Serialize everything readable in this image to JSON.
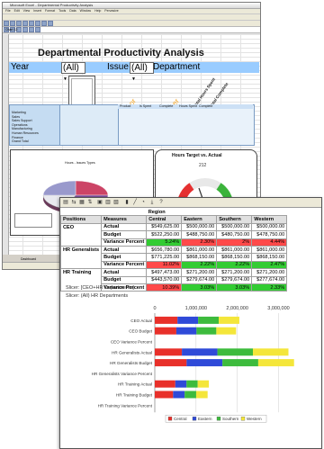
{
  "excel": {
    "window_title": "Microsoft Excel - Departmental Productivity Analysis",
    "menu": [
      "File",
      "Edit",
      "View",
      "Insert",
      "Format",
      "Tools",
      "Data",
      "Window",
      "Help",
      "Pervasive"
    ],
    "name_box": "Chart 12",
    "sheet_title": "Departmental Productivity Analysis",
    "slicers": {
      "year_label": "Year",
      "year_value": "(All)",
      "issue_label": "Issue",
      "issue_value": "(All)",
      "department_label": "Department"
    },
    "rotated_labels": {
      "minor": "Minor",
      "other": "Other",
      "total_hours": "Total Hours Spent",
      "total_complete": "Total Complete"
    },
    "small_headers": [
      "Product",
      "Is Spent",
      "Complete",
      "Hours Spent",
      "Complete"
    ],
    "departments": [
      "Marketing",
      "Sales",
      "Sales Support",
      "Operations",
      "Manufacturing",
      "Human Resources",
      "Finance",
      "Grand Total"
    ],
    "chart_title": "Hours Target vs. Actual",
    "gauge_value": "212",
    "pie_title": "Hours - Issues Types",
    "sheet_tab": "Dashboard"
  },
  "pivot": {
    "region_label": "Region",
    "col_headers": [
      "Positions",
      "Measures",
      "Central",
      "Eastern",
      "Southern",
      "Western"
    ],
    "rows": [
      {
        "position": "CEO",
        "measure": "Actual",
        "central": "$549,625.00",
        "eastern": "$500,000.00",
        "southern": "$500,000.00",
        "western": "$500,000.00"
      },
      {
        "position": "",
        "measure": "Budget",
        "central": "$522,250.00",
        "eastern": "$488,750.00",
        "southern": "$480,750.00",
        "western": "$478,750.00"
      },
      {
        "position": "",
        "measure": "Variance Percent",
        "central": "5.24%",
        "eastern": "2.30%",
        "southern": "2%",
        "western": "4.44%"
      },
      {
        "position": "HR Generalists",
        "measure": "Actual",
        "central": "$656,780.00",
        "eastern": "$861,000.00",
        "southern": "$861,000.00",
        "western": "$861,000.00"
      },
      {
        "position": "",
        "measure": "Budget",
        "central": "$771,225.00",
        "eastern": "$868,150.00",
        "southern": "$868,150.00",
        "western": "$868,150.00"
      },
      {
        "position": "",
        "measure": "Variance Percent",
        "central": "11.02%",
        "eastern": "2.22%",
        "southern": "2.22%",
        "western": "2.47%"
      },
      {
        "position": "HR Training",
        "measure": "Actual",
        "central": "$497,473.00",
        "eastern": "$271,200.00",
        "southern": "$271,200.00",
        "western": "$271,200.00"
      },
      {
        "position": "",
        "measure": "Budget",
        "central": "$443,570.00",
        "eastern": "$279,674.00",
        "southern": "$279,674.00",
        "western": "$277,674.00"
      },
      {
        "position": "",
        "measure": "Variance Percent",
        "central": "10.39%",
        "eastern": "3.03%",
        "southern": "3.03%",
        "western": "2.33%"
      }
    ],
    "slicer_line1": "Slicer: [CEO+HR Departments]",
    "slicer_line2": "Slicer: (All) HR Departments"
  },
  "chart_data": {
    "type": "bar",
    "orientation": "horizontal",
    "stacked": true,
    "categories": [
      "CEO Actual",
      "CEO Budget",
      "CEO Variance Percent",
      "HR Generalists Actual",
      "HR Generalists Budget",
      "HR Generalists Variance Percent",
      "HR Training Actual",
      "HR Training Budget",
      "HR Training Variance Percent"
    ],
    "series": [
      {
        "name": "Central",
        "color": "#e8302a",
        "values": [
          549625,
          522250,
          0.0524,
          656780,
          771225,
          0.1102,
          497473,
          443570,
          0.1039
        ]
      },
      {
        "name": "Eastern",
        "color": "#2f4ad8",
        "values": [
          500000,
          488750,
          0.023,
          861000,
          868150,
          0.0222,
          271200,
          279674,
          0.0303
        ]
      },
      {
        "name": "Southern",
        "color": "#3dbb3d",
        "values": [
          500000,
          480750,
          0.02,
          861000,
          868150,
          0.0222,
          271200,
          279674,
          0.0303
        ]
      },
      {
        "name": "Western",
        "color": "#f4e63a",
        "values": [
          500000,
          478750,
          0.0444,
          861000,
          868150,
          0.0247,
          271200,
          277674,
          0.0233
        ]
      }
    ],
    "xticks": [
      "0",
      "1,000,000",
      "2,000,000",
      "3,000,000"
    ],
    "xlim": [
      0,
      3600000
    ],
    "grid": true,
    "legend": "bottom"
  }
}
